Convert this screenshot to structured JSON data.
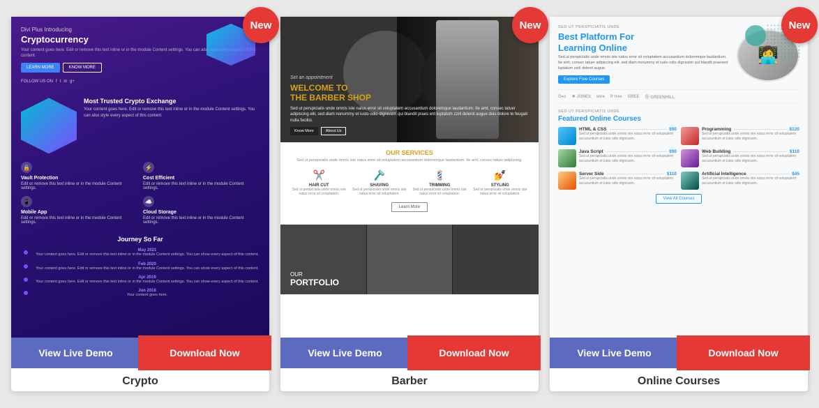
{
  "cards": [
    {
      "id": "crypto",
      "badge": "New",
      "label": "Crypto",
      "live_demo_label": "View Live Demo",
      "download_label": "Download Now",
      "preview": {
        "header": "Divi Plus Introducing",
        "title": "Cryptocurrency",
        "subtitle": "Your content goes here. Edit or remove this text inline or in the module Content settings. You can also style every aspect of this content.",
        "btn1": "LEARN MORE",
        "btn2": "KNOW MORE",
        "social_label": "FOLLOW US ON",
        "mid_title": "Most Trusted Crypto Exchange",
        "mid_text": "Your content goes here. Edit or remove this text inline or in the module Content settings. You can also style every aspect of this content.",
        "features": [
          {
            "icon": "🔒",
            "title": "Vault Protection",
            "desc": "Edit or remove this text inline or in the module Content settings."
          },
          {
            "icon": "⚡",
            "title": "Cost Efficient",
            "desc": "Edit or remove this text inline or in the module Content settings."
          },
          {
            "icon": "📱",
            "title": "Mobile App",
            "desc": "Edit or remove this text inline or in the module Content settings."
          },
          {
            "icon": "☁️",
            "title": "Cloud Storage",
            "desc": "Edit or remove this text inline or in the module Content settings."
          }
        ],
        "journey_title": "Journey So Far",
        "timeline": [
          {
            "date": "May 2021",
            "text": "Your content goes here. Edit or remove this text inline or in the module Content settings. You can show every aspect of this content."
          },
          {
            "date": "Feb 2020",
            "text": "Your content goes here. Edit or remove this text inline or in the module Content settings. You can show every aspect of this content."
          },
          {
            "date": "Apr 2019",
            "text": "Your content goes here. Edit or remove this text inline or in the module Content settings. You can show every aspect of this content."
          },
          {
            "date": "Jun 2018",
            "text": "Your content goes here."
          }
        ]
      }
    },
    {
      "id": "barber",
      "badge": "New",
      "label": "Barber",
      "live_demo_label": "View Live Demo",
      "download_label": "Download Now",
      "preview": {
        "hero_heading1": "WELCOME TO",
        "hero_heading2": "THE BARBER SHOP",
        "hero_text": "Sed ut perspiciatis unde omnis iste natus error sit voluptatem accusantium doloremque laudantium. Ite amt, consec tatuer adipiscing elit, sed diam nonummy et iusto odio dignissim qui blandit praes ent luptatum zzril delenit augue duis dolore te feugait nulla facilisi.",
        "hero_btn1": "Know More",
        "hero_btn2": "About Us",
        "services_title": "OUR",
        "services_title2": "SERVICES",
        "services_desc": "Sed ut perspiciatis unde omnis iste natus error sit voluptatem accusantium doloremque laudantium. Ite amt, consec tatuer adipiscing.",
        "services": [
          {
            "icon": "✂️",
            "name": "HAIR CUT",
            "desc": "Sed ut perspiciatis unde omnis iste natus error sit voluptatem."
          },
          {
            "icon": "🪒",
            "name": "SHAVING",
            "desc": "Sed ut perspiciatis unde omnis iste natus error sit voluptatem."
          },
          {
            "icon": "💈",
            "name": "TRIMMING",
            "desc": "Sed ut perspiciatis unde omnis iste natus error sit voluptatem."
          },
          {
            "icon": "💅",
            "name": "STYLING",
            "desc": "Sed ut perspiciatis unde omnis iste natus error sit voluptatem."
          }
        ],
        "learn_btn": "Learn More",
        "portfolio_label1": "OUR",
        "portfolio_label2": "PORTFOLIO"
      }
    },
    {
      "id": "online-courses",
      "badge": "New",
      "label": "Online Courses",
      "live_demo_label": "View Live Demo",
      "download_label": "Download Now",
      "preview": {
        "top_label": "SED UT PERSPICIATIS UNDE",
        "hero_title1": "Best Platform For",
        "hero_title2": "Learning Online",
        "hero_desc": "Sed ut perspiciatis unde omnis iste natus error sit voluptatem accusantium doloremque laudantium. Ite amt, consec tatuer adipiscing elit, sed diam nonummy et iusto odio dignissim qui blandit praesent luptatum zzril delenit augue.",
        "cta_btn": "Explore Free Courses",
        "logos": [
          "O●c",
          "❖ JONES",
          "wire",
          "P tree",
          "GREE",
          "⓪ GREENHILL"
        ],
        "section_label": "SED UT PERSPICIATIS UNDE",
        "section_title1": "Featured Online",
        "section_title2": "Courses",
        "courses": [
          {
            "name": "HTML & CSS",
            "price": "$90",
            "desc": "Sed ut perspiciatis unde omnis iste natus error sit voluptatem accusantium et iusto odio dignissim."
          },
          {
            "name": "Programming",
            "price": "$120",
            "desc": "Sed ut perspiciatis unde omnis iste natus error sit voluptatem accusantium et iusto odio dignissim."
          },
          {
            "name": "Java Script",
            "price": "$90",
            "desc": "Sed ut perspiciatis unde omnis iste natus error sit voluptatem accusantium et iusto odio dignissim."
          },
          {
            "name": "Web Building",
            "price": "$110",
            "desc": "Sed ut perspiciatis unde omnis iste natus error sit voluptatem accusantium et iusto odio dignissim."
          },
          {
            "name": "Server Side",
            "price": "$110",
            "desc": "Sed ut perspiciatis unde omnis iste natus error sit voluptatem accusantium et iusto odio dignissim."
          },
          {
            "name": "Artificial Intelligence",
            "price": "$45",
            "desc": "Sed ut perspiciatis unde omnis iste natus error sit voluptatem accusantium et iusto odio dignissim."
          }
        ],
        "view_btn": "View All Courses"
      }
    }
  ]
}
